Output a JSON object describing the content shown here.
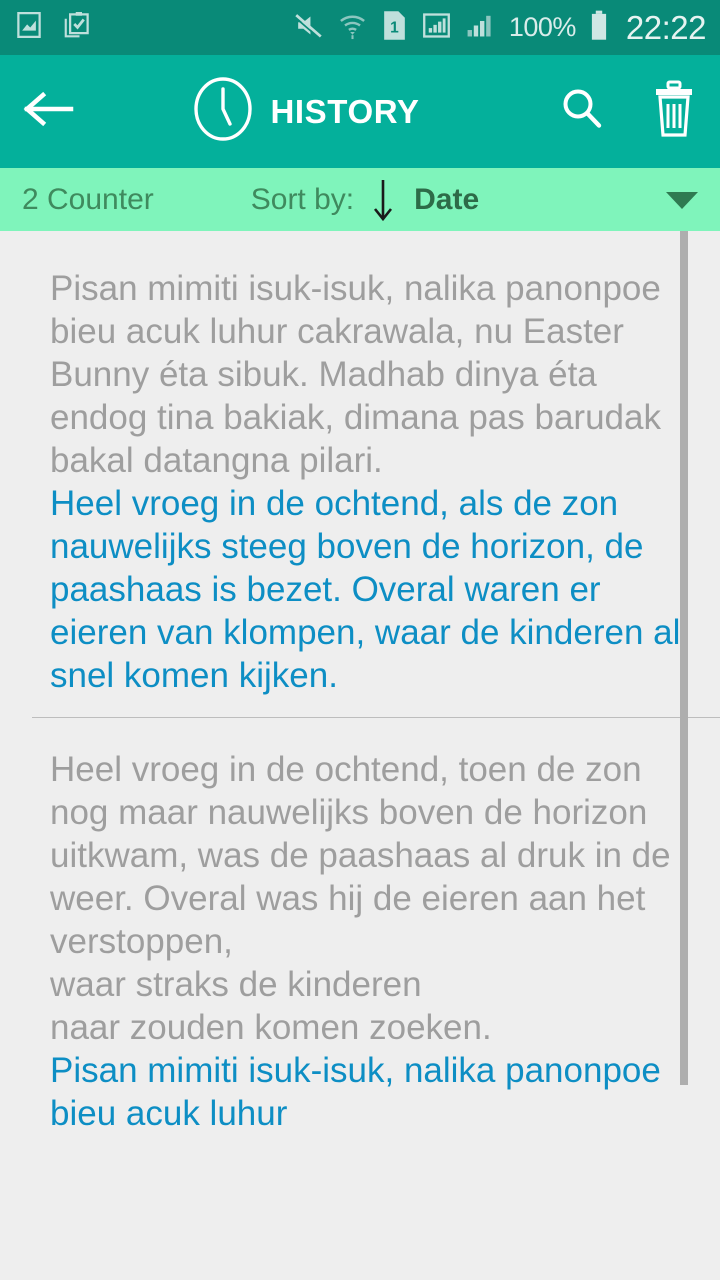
{
  "status_bar": {
    "icons_left": [
      "image-icon",
      "clipboard-check-icon"
    ],
    "icons_right": [
      "mute-icon",
      "wifi-icon",
      "sim-1-icon",
      "signal-boxed-icon",
      "signal-bars-icon"
    ],
    "sim_label": "1",
    "battery_percent": "100%",
    "clock": "22:22",
    "background_color": "#098a78"
  },
  "app_bar": {
    "back_icon": "back-arrow-icon",
    "clock_icon": "clock-icon",
    "title": "HISTORY",
    "search_icon": "search-icon",
    "delete_icon": "trash-icon",
    "background_color": "#04b09b"
  },
  "sort_bar": {
    "counter_label": "2 Counter",
    "sort_by_label": "Sort by:",
    "sort_direction_icon": "arrow-down-icon",
    "sort_value": "Date",
    "dropdown_icon": "chevron-down-icon",
    "background_color": "#7ff4bb"
  },
  "history": {
    "items": [
      {
        "source_text": "Pisan mimiti isuk-isuk, nalika panonpoe bieu acuk luhur cakrawala, nu Easter Bunny éta sibuk. Madhab dinya éta endog tina bakiak, dimana pas barudak bakal datangna pilari.",
        "translated_text": "Heel vroeg in de ochtend, als de zon nauwelijks steeg boven de horizon, de paashaas is bezet. Overal waren er eieren van klompen, waar de kinderen al snel komen kijken."
      },
      {
        "source_text": "Heel vroeg in de ochtend, toen de zon nog maar nauwelijks boven de horizon uitkwam, was de paashaas al druk in de weer. Overal was hij de eieren aan het verstoppen,\nwaar straks de kinderen\nnaar zouden komen zoeken.",
        "translated_text": "Pisan mimiti isuk-isuk, nalika panonpoe bieu acuk luhur"
      }
    ],
    "source_text_color": "#9e9e9e",
    "translated_text_color": "#0d8ec4",
    "background_color": "#eeeeee"
  },
  "scrollbar": {
    "thumb_color": "#aeaeae"
  }
}
